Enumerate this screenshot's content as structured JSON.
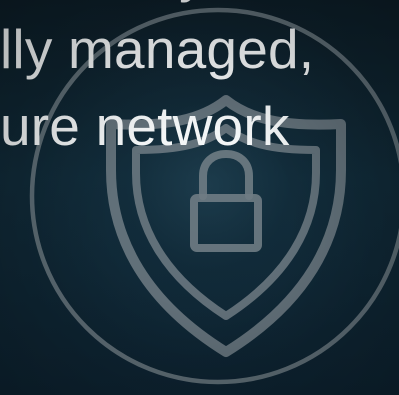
{
  "hero": {
    "lines": [
      "ride fully",
      "lly managed,",
      "ure network"
    ]
  },
  "colors": {
    "background": "#0f2330",
    "text": "#f3f6f7",
    "emblem_stroke": "#6f7c84"
  },
  "icons": {
    "emblem": "shield-lock-icon"
  }
}
